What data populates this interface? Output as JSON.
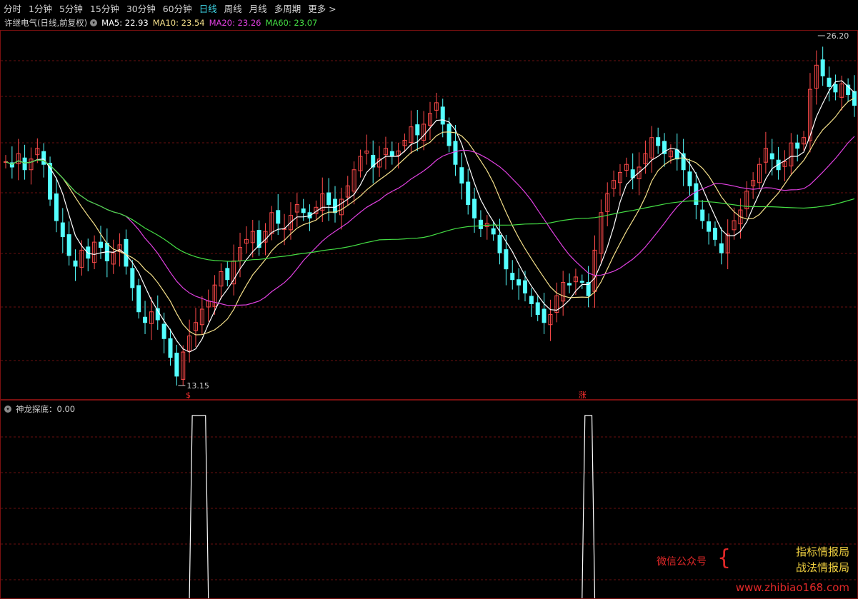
{
  "tabs": [
    {
      "label": "分时",
      "active": false
    },
    {
      "label": "1分钟",
      "active": false
    },
    {
      "label": "5分钟",
      "active": false
    },
    {
      "label": "15分钟",
      "active": false
    },
    {
      "label": "30分钟",
      "active": false
    },
    {
      "label": "60分钟",
      "active": false
    },
    {
      "label": "日线",
      "active": true
    },
    {
      "label": "周线",
      "active": false
    },
    {
      "label": "月线",
      "active": false
    },
    {
      "label": "多周期",
      "active": false
    },
    {
      "label": "更多 >",
      "active": false
    }
  ],
  "chart_title": "许继电气(日线,前复权)",
  "ma": [
    {
      "label": "MA5: 22.93",
      "color": "#ffffff"
    },
    {
      "label": "MA10: 23.54",
      "color": "#f5e08a"
    },
    {
      "label": "MA20: 23.26",
      "color": "#e040e0"
    },
    {
      "label": "MA60: 23.07",
      "color": "#44dd44"
    }
  ],
  "high_label": "26.20",
  "low_label": "13.15",
  "markers": [
    {
      "text": "$",
      "color": "#ff3030"
    },
    {
      "text": "涨",
      "color": "#ff3030"
    }
  ],
  "indicator_title": "神龙探底：0.00",
  "watermark": {
    "left": "微信公众号",
    "right_line1": "指标情报局",
    "right_line2": "战法情报局",
    "url": "www.zhibiao168.com"
  },
  "colors": {
    "up": "#ff4a4a",
    "down": "#54ffff",
    "ma5": "#ffffff",
    "ma10": "#f5e08a",
    "ma20": "#e040e0",
    "ma60": "#44dd44",
    "grid": "#6a1010",
    "active_tab": "#3fd9ea"
  },
  "chart_data": {
    "type": "candlestick",
    "title": "许继电气(日线,前复权)",
    "price_range": [
      13.15,
      26.2
    ],
    "high": 26.2,
    "low": 13.15,
    "ma_last": {
      "MA5": 22.93,
      "MA10": 23.54,
      "MA20": 23.26,
      "MA60": 23.07
    },
    "closes": [
      21.5,
      21.3,
      21.8,
      21.2,
      21.6,
      22.0,
      21.4,
      20.1,
      19.3,
      18.7,
      18.0,
      17.6,
      18.2,
      17.9,
      18.5,
      18.3,
      17.8,
      18.1,
      18.4,
      17.6,
      16.8,
      15.9,
      15.5,
      15.9,
      15.6,
      14.9,
      14.2,
      13.5,
      14.4,
      15.0,
      15.5,
      16.0,
      16.3,
      16.9,
      17.4,
      17.1,
      17.8,
      18.3,
      18.6,
      18.9,
      18.3,
      18.9,
      19.6,
      19.2,
      19.0,
      19.5,
      19.9,
      19.6,
      19.4,
      19.8,
      20.3,
      19.9,
      19.6,
      20.1,
      20.6,
      21.2,
      21.7,
      21.9,
      21.3,
      21.6,
      22.0,
      21.7,
      21.9,
      22.3,
      22.8,
      22.5,
      22.9,
      23.3,
      23.7,
      22.9,
      22.1,
      21.4,
      20.7,
      19.9,
      19.4,
      19.0,
      19.2,
      18.8,
      18.1,
      17.5,
      17.1,
      16.9,
      16.6,
      16.2,
      15.8,
      15.5,
      15.8,
      16.5,
      17.0,
      16.9,
      17.2,
      17.0,
      16.5,
      18.2,
      19.6,
      20.3,
      20.8,
      21.1,
      21.4,
      20.9,
      21.3,
      21.8,
      22.4,
      22.1,
      21.8,
      21.9,
      21.6,
      21.2,
      20.6,
      19.9,
      19.3,
      18.9,
      18.6,
      18.1,
      18.8,
      19.3,
      19.7,
      20.4,
      20.8,
      21.4,
      22.0,
      21.6,
      21.2,
      21.5,
      22.2,
      22.0,
      22.4,
      24.2,
      25.1,
      24.7,
      24.3,
      24.1,
      24.4,
      24.0,
      23.6
    ]
  },
  "indicator_data": {
    "type": "line",
    "name": "神龙探底",
    "value": 0.0,
    "pulses": [
      {
        "start_index": 29,
        "end_index": 32
      },
      {
        "start_index": 91,
        "end_index": 93
      }
    ]
  }
}
